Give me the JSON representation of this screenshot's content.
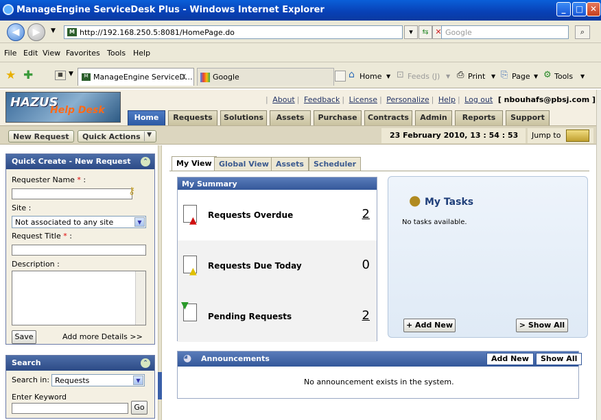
{
  "browser": {
    "title": "ManageEngine ServiceDesk Plus - Windows Internet Explorer",
    "url": "http://192.168.250.5:8081/HomePage.do",
    "search_placeholder": "Google",
    "menu": [
      "File",
      "Edit",
      "View",
      "Favorites",
      "Tools",
      "Help"
    ],
    "tabs": [
      {
        "label": "ManageEngine ServiceD...",
        "close": "X"
      },
      {
        "label": "Google"
      }
    ],
    "commands": {
      "home": "Home",
      "feeds": "Feeds (J)",
      "print": "Print",
      "page": "Page",
      "tools": "Tools"
    }
  },
  "app": {
    "logo_main": "HAZUS",
    "logo_sub": "Help Desk",
    "top_links": [
      "About",
      "Feedback",
      "License",
      "Personalize",
      "Help",
      "Log out"
    ],
    "user": "[ nbouhafs@pbsj.com ]",
    "module_tabs": [
      "Home",
      "Requests",
      "Solutions",
      "Assets",
      "Purchase",
      "Contracts",
      "Admin",
      "Reports",
      "Support"
    ],
    "active_tab": "Home",
    "new_request": "New Request",
    "quick_actions": "Quick Actions",
    "datetime": "23 February 2010, 13 : 54 : 53",
    "jump_to": "Jump to"
  },
  "quick_create": {
    "title": "Quick Create - New Request",
    "requester_label": "Requester Name",
    "site_label": "Site :",
    "site_value": "Not associated to any site",
    "title_label": "Request Title",
    "description_label": "Description :",
    "save": "Save",
    "add_more": "Add more Details >>",
    "required_mark": "*",
    "colon": " :"
  },
  "search": {
    "title": "Search",
    "search_in_label": "Search in:",
    "search_in_value": "Requests",
    "keyword_label": "Enter Keyword",
    "go": "Go"
  },
  "views": [
    "My View",
    "Global View",
    "Assets",
    "Scheduler"
  ],
  "summary": {
    "title": "My Summary",
    "rows": [
      {
        "label": "Requests Overdue",
        "count": "2"
      },
      {
        "label": "Requests Due Today",
        "count": "0"
      },
      {
        "label": "Pending Requests",
        "count": "2"
      }
    ]
  },
  "tasks": {
    "title": "My Tasks",
    "empty": "No tasks available.",
    "add_new": "+ Add New",
    "show_all": "> Show All"
  },
  "announcements": {
    "title": "Announcements",
    "add_new": "Add New",
    "show_all": "Show All",
    "empty": "No announcement exists in the system."
  }
}
